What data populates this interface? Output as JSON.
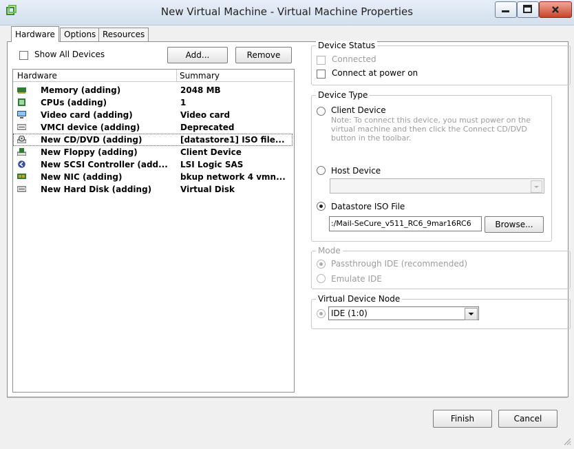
{
  "window": {
    "title": "New Virtual Machine - Virtual Machine Properties"
  },
  "tabs": [
    {
      "label": "Hardware",
      "active": true
    },
    {
      "label": "Options",
      "active": false
    },
    {
      "label": "Resources",
      "active": false
    }
  ],
  "left": {
    "show_all_devices_label": "Show All Devices",
    "show_all_devices_checked": false,
    "add_label": "Add...",
    "remove_label": "Remove",
    "columns": [
      "Hardware",
      "Summary"
    ],
    "rows": [
      {
        "icon": "memory-icon",
        "hardware": "Memory (adding)",
        "summary": "2048 MB"
      },
      {
        "icon": "cpu-icon",
        "hardware": "CPUs (adding)",
        "summary": "1"
      },
      {
        "icon": "monitor-icon",
        "hardware": "Video card  (adding)",
        "summary": "Video card"
      },
      {
        "icon": "vmci-device-icon",
        "hardware": "VMCI device (adding)",
        "summary": "Deprecated"
      },
      {
        "icon": "cd-dvd-icon",
        "hardware": "New CD/DVD (adding)",
        "summary": "[datastore1] ISO file...",
        "selected": true
      },
      {
        "icon": "floppy-icon",
        "hardware": "New Floppy (adding)",
        "summary": "Client Device"
      },
      {
        "icon": "scsi-controller-icon",
        "hardware": "New SCSI Controller (add...",
        "summary": "LSI Logic SAS"
      },
      {
        "icon": "nic-icon",
        "hardware": "New NIC (adding)",
        "summary": "bkup network 4 vmn..."
      },
      {
        "icon": "hard-disk-icon",
        "hardware": "New Hard Disk (adding)",
        "summary": "Virtual Disk"
      }
    ]
  },
  "right": {
    "device_status": {
      "label": "Device Status",
      "connected_label": "Connected",
      "connected_checked": false,
      "connect_power_on_label": "Connect at power on",
      "connect_power_on_checked": false
    },
    "device_type": {
      "label": "Device Type",
      "client_device_label": "Client Device",
      "client_note": "Note: To connect this device, you must power on the virtual machine and then click the Connect CD/DVD button in the toolbar.",
      "host_device_label": "Host Device",
      "host_device_value": "",
      "datastore_iso_label": "Datastore ISO File",
      "datastore_iso_value": ":/Mail-SeCure_v511_RC6_9mar16RC6",
      "browse_label": "Browse...",
      "selected": "datastore_iso"
    },
    "mode": {
      "label": "Mode",
      "passthrough_label": "Passthrough IDE (recommended)",
      "emulate_label": "Emulate IDE",
      "selected": "passthrough"
    },
    "virtual_device_node": {
      "label": "Virtual Device Node",
      "value": "IDE (1:0)"
    }
  },
  "footer": {
    "finish_label": "Finish",
    "cancel_label": "Cancel"
  }
}
